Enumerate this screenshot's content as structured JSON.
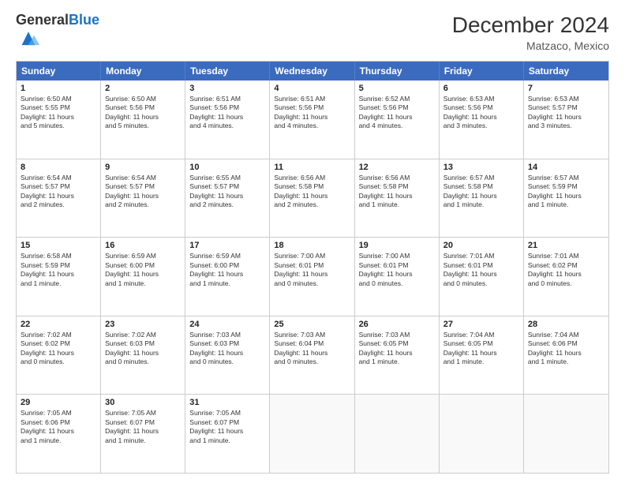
{
  "header": {
    "logo_general": "General",
    "logo_blue": "Blue",
    "month": "December 2024",
    "location": "Matzaco, Mexico"
  },
  "weekdays": [
    "Sunday",
    "Monday",
    "Tuesday",
    "Wednesday",
    "Thursday",
    "Friday",
    "Saturday"
  ],
  "rows": [
    [
      {
        "day": "1",
        "lines": [
          "Sunrise: 6:50 AM",
          "Sunset: 5:55 PM",
          "Daylight: 11 hours",
          "and 5 minutes."
        ]
      },
      {
        "day": "2",
        "lines": [
          "Sunrise: 6:50 AM",
          "Sunset: 5:56 PM",
          "Daylight: 11 hours",
          "and 5 minutes."
        ]
      },
      {
        "day": "3",
        "lines": [
          "Sunrise: 6:51 AM",
          "Sunset: 5:56 PM",
          "Daylight: 11 hours",
          "and 4 minutes."
        ]
      },
      {
        "day": "4",
        "lines": [
          "Sunrise: 6:51 AM",
          "Sunset: 5:56 PM",
          "Daylight: 11 hours",
          "and 4 minutes."
        ]
      },
      {
        "day": "5",
        "lines": [
          "Sunrise: 6:52 AM",
          "Sunset: 5:56 PM",
          "Daylight: 11 hours",
          "and 4 minutes."
        ]
      },
      {
        "day": "6",
        "lines": [
          "Sunrise: 6:53 AM",
          "Sunset: 5:56 PM",
          "Daylight: 11 hours",
          "and 3 minutes."
        ]
      },
      {
        "day": "7",
        "lines": [
          "Sunrise: 6:53 AM",
          "Sunset: 5:57 PM",
          "Daylight: 11 hours",
          "and 3 minutes."
        ]
      }
    ],
    [
      {
        "day": "8",
        "lines": [
          "Sunrise: 6:54 AM",
          "Sunset: 5:57 PM",
          "Daylight: 11 hours",
          "and 2 minutes."
        ]
      },
      {
        "day": "9",
        "lines": [
          "Sunrise: 6:54 AM",
          "Sunset: 5:57 PM",
          "Daylight: 11 hours",
          "and 2 minutes."
        ]
      },
      {
        "day": "10",
        "lines": [
          "Sunrise: 6:55 AM",
          "Sunset: 5:57 PM",
          "Daylight: 11 hours",
          "and 2 minutes."
        ]
      },
      {
        "day": "11",
        "lines": [
          "Sunrise: 6:56 AM",
          "Sunset: 5:58 PM",
          "Daylight: 11 hours",
          "and 2 minutes."
        ]
      },
      {
        "day": "12",
        "lines": [
          "Sunrise: 6:56 AM",
          "Sunset: 5:58 PM",
          "Daylight: 11 hours",
          "and 1 minute."
        ]
      },
      {
        "day": "13",
        "lines": [
          "Sunrise: 6:57 AM",
          "Sunset: 5:58 PM",
          "Daylight: 11 hours",
          "and 1 minute."
        ]
      },
      {
        "day": "14",
        "lines": [
          "Sunrise: 6:57 AM",
          "Sunset: 5:59 PM",
          "Daylight: 11 hours",
          "and 1 minute."
        ]
      }
    ],
    [
      {
        "day": "15",
        "lines": [
          "Sunrise: 6:58 AM",
          "Sunset: 5:59 PM",
          "Daylight: 11 hours",
          "and 1 minute."
        ]
      },
      {
        "day": "16",
        "lines": [
          "Sunrise: 6:59 AM",
          "Sunset: 6:00 PM",
          "Daylight: 11 hours",
          "and 1 minute."
        ]
      },
      {
        "day": "17",
        "lines": [
          "Sunrise: 6:59 AM",
          "Sunset: 6:00 PM",
          "Daylight: 11 hours",
          "and 1 minute."
        ]
      },
      {
        "day": "18",
        "lines": [
          "Sunrise: 7:00 AM",
          "Sunset: 6:01 PM",
          "Daylight: 11 hours",
          "and 0 minutes."
        ]
      },
      {
        "day": "19",
        "lines": [
          "Sunrise: 7:00 AM",
          "Sunset: 6:01 PM",
          "Daylight: 11 hours",
          "and 0 minutes."
        ]
      },
      {
        "day": "20",
        "lines": [
          "Sunrise: 7:01 AM",
          "Sunset: 6:01 PM",
          "Daylight: 11 hours",
          "and 0 minutes."
        ]
      },
      {
        "day": "21",
        "lines": [
          "Sunrise: 7:01 AM",
          "Sunset: 6:02 PM",
          "Daylight: 11 hours",
          "and 0 minutes."
        ]
      }
    ],
    [
      {
        "day": "22",
        "lines": [
          "Sunrise: 7:02 AM",
          "Sunset: 6:02 PM",
          "Daylight: 11 hours",
          "and 0 minutes."
        ]
      },
      {
        "day": "23",
        "lines": [
          "Sunrise: 7:02 AM",
          "Sunset: 6:03 PM",
          "Daylight: 11 hours",
          "and 0 minutes."
        ]
      },
      {
        "day": "24",
        "lines": [
          "Sunrise: 7:03 AM",
          "Sunset: 6:03 PM",
          "Daylight: 11 hours",
          "and 0 minutes."
        ]
      },
      {
        "day": "25",
        "lines": [
          "Sunrise: 7:03 AM",
          "Sunset: 6:04 PM",
          "Daylight: 11 hours",
          "and 0 minutes."
        ]
      },
      {
        "day": "26",
        "lines": [
          "Sunrise: 7:03 AM",
          "Sunset: 6:05 PM",
          "Daylight: 11 hours",
          "and 1 minute."
        ]
      },
      {
        "day": "27",
        "lines": [
          "Sunrise: 7:04 AM",
          "Sunset: 6:05 PM",
          "Daylight: 11 hours",
          "and 1 minute."
        ]
      },
      {
        "day": "28",
        "lines": [
          "Sunrise: 7:04 AM",
          "Sunset: 6:06 PM",
          "Daylight: 11 hours",
          "and 1 minute."
        ]
      }
    ],
    [
      {
        "day": "29",
        "lines": [
          "Sunrise: 7:05 AM",
          "Sunset: 6:06 PM",
          "Daylight: 11 hours",
          "and 1 minute."
        ]
      },
      {
        "day": "30",
        "lines": [
          "Sunrise: 7:05 AM",
          "Sunset: 6:07 PM",
          "Daylight: 11 hours",
          "and 1 minute."
        ]
      },
      {
        "day": "31",
        "lines": [
          "Sunrise: 7:05 AM",
          "Sunset: 6:07 PM",
          "Daylight: 11 hours",
          "and 1 minute."
        ]
      },
      {
        "day": "",
        "lines": []
      },
      {
        "day": "",
        "lines": []
      },
      {
        "day": "",
        "lines": []
      },
      {
        "day": "",
        "lines": []
      }
    ]
  ]
}
